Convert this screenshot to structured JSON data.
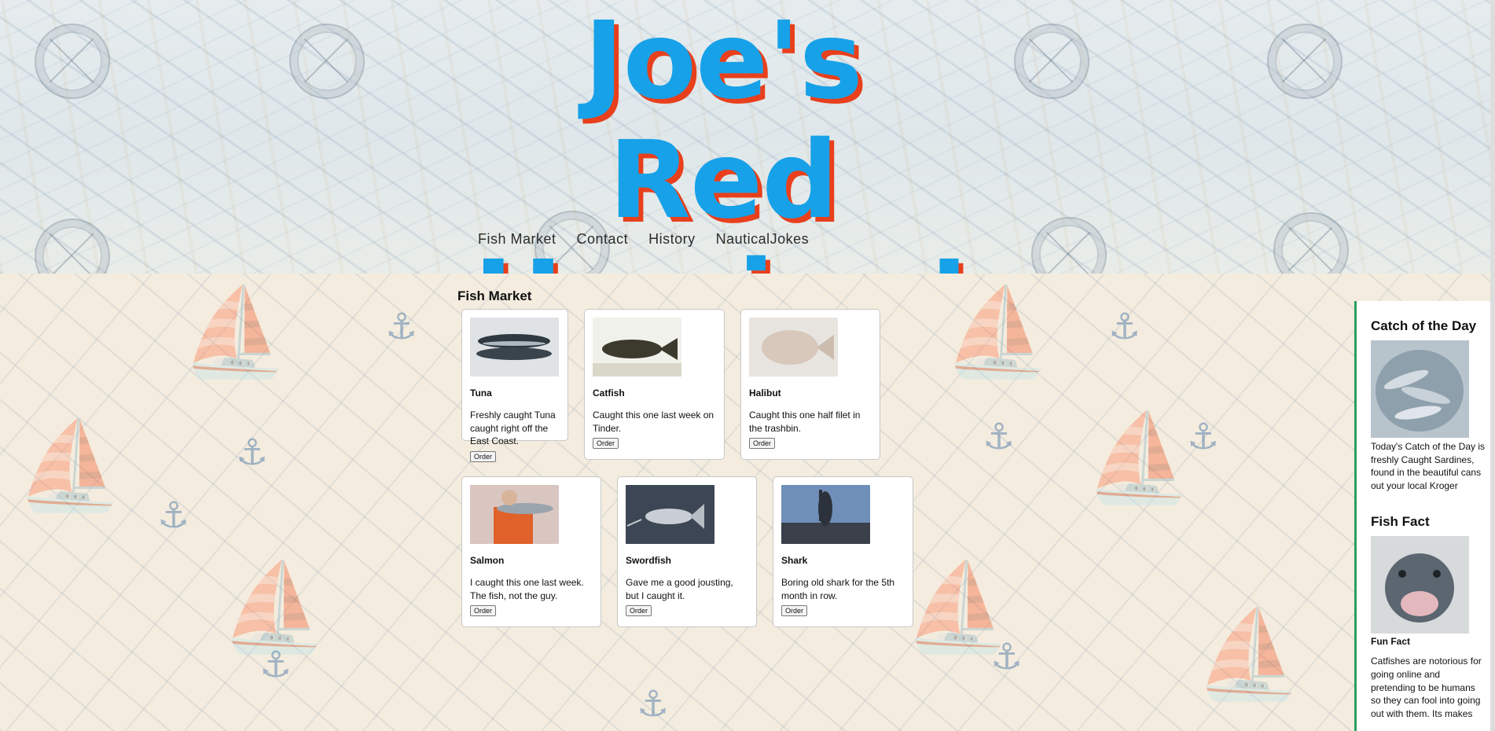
{
  "site": {
    "title": "Joe's Red Herring!",
    "nav": [
      "Fish Market",
      "Contact",
      "History",
      "NauticalJokes"
    ]
  },
  "market": {
    "heading": "Fish Market",
    "order_label": "Order",
    "items": [
      {
        "name": "Tuna",
        "description": "Freshly caught Tuna caught right off the East Coast.",
        "image_icon": "tuna-photo"
      },
      {
        "name": "Catfish",
        "description": "Caught this one last week on Tinder.",
        "image_icon": "catfish-photo"
      },
      {
        "name": "Halibut",
        "description": "Caught this one half filet in the trashbin.",
        "image_icon": "halibut-photo"
      },
      {
        "name": "Salmon",
        "description": "I caught this one last week. The fish, not the guy.",
        "image_icon": "salmon-photo"
      },
      {
        "name": "Swordfish",
        "description": "Gave me a good jousting, but I caught it.",
        "image_icon": "swordfish-photo"
      },
      {
        "name": "Shark",
        "description": "Boring old shark for the 5th month in row.",
        "image_icon": "shark-photo"
      }
    ]
  },
  "sidebar": {
    "catch_heading": "Catch of the Day",
    "catch_text": "Today's Catch of the Day is freshly Caught Sardines, found in the beautiful cans out your local Kroger",
    "fact_heading": "Fish Fact",
    "fact_label": "Fun Fact",
    "fact_text": "Catfishes are notorious for going online and pretending to be humans so they can fool into going out with them. Its makes"
  },
  "colors": {
    "title": "#17a1e8",
    "title_shadow": "#e8401c",
    "sidebar_border": "#2a9d5c",
    "pattern": "#5e86ad"
  }
}
